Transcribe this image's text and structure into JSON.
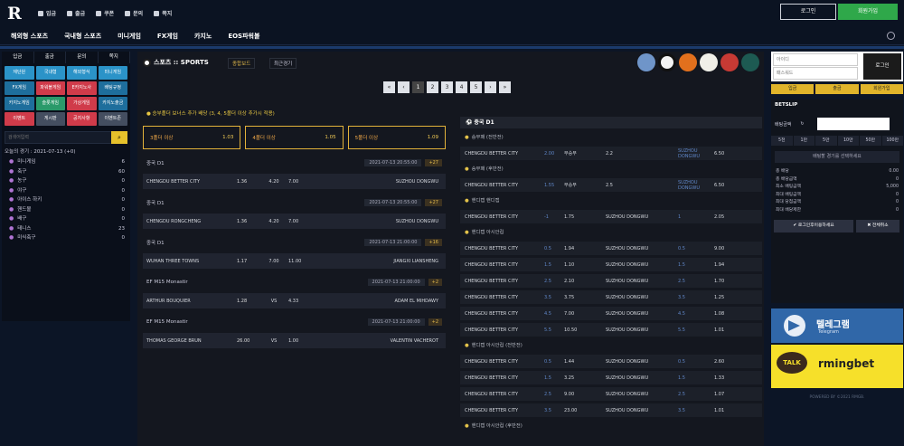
{
  "header": {
    "logo": "R",
    "links": [
      "입금",
      "출금",
      "쿠폰",
      "문의",
      "쪽지"
    ],
    "login": "로그인",
    "join": "회원가입"
  },
  "nav": {
    "items": [
      "해외형 스포츠",
      "국내형 스포츠",
      "미니게임",
      "FX게임",
      "카지노",
      "EOS파워볼"
    ]
  },
  "left": {
    "tabs": [
      "입금",
      "출금",
      "문의",
      "쪽지"
    ],
    "grid": [
      [
        "재단원",
        "#2b93c8"
      ],
      [
        "국내형",
        "#2b93c8"
      ],
      [
        "해외형식",
        "#2b93c8"
      ],
      [
        "미니게임",
        "#2b93c8"
      ],
      [
        "FX게임",
        "#1e6e9c"
      ],
      [
        "파워볼게임",
        "#d03b4a"
      ],
      [
        "E카지노사",
        "#d03b4a"
      ],
      [
        "배팅규정",
        "#1e6e9c"
      ],
      [
        "카지노게임",
        "#1e6e9c"
      ],
      [
        "슬롯게임",
        "#2a9a6a"
      ],
      [
        "가상게임",
        "#d03b4a"
      ],
      [
        "카지노출금",
        "#1e6e9c"
      ],
      [
        "이벤트",
        "#d03b4a"
      ],
      [
        "게시판",
        "#444e60"
      ],
      [
        "공지사항",
        "#d03b4a"
      ],
      [
        "이벤트존",
        "#444e60"
      ]
    ],
    "search_placeholder": "검색어입력",
    "today": "오늘의 경기 : 2021-07-13 (+0)",
    "sports": [
      [
        "미니게임",
        "6"
      ],
      [
        "축구",
        "60"
      ],
      [
        "농구",
        "0"
      ],
      [
        "야구",
        "0"
      ],
      [
        "아이스 하키",
        "0"
      ],
      [
        "핸드볼",
        "0"
      ],
      [
        "배구",
        "0"
      ],
      [
        "테니스",
        "23"
      ],
      [
        "미식축구",
        "0"
      ]
    ]
  },
  "center": {
    "title": "스포츠 :: SPORTS",
    "tab1": "종합보드",
    "tab2": "최근경기",
    "pages": [
      "«",
      "‹",
      "1",
      "2",
      "3",
      "4",
      "5",
      "›",
      "»"
    ],
    "notice": "● 승부폴더 보너스 추가 배당 (3, 4, 5폴더 이상 추가시 적용)",
    "bonus": [
      {
        "label": "3폴더 이상",
        "val": "1.03"
      },
      {
        "label": "4폴더 이상",
        "val": "1.05"
      },
      {
        "label": "5폴더 이상",
        "val": "1.09"
      }
    ],
    "matches": [
      {
        "league": "중국 D1",
        "date": "2021-07-13 20:55:00",
        "plus": "+27",
        "home": "CHENGDU BETTER CITY",
        "ho": "1.36",
        "dr": "4.20",
        "ao": "7.00",
        "away": "SUZHOU DONGWU"
      },
      {
        "league": "중국 D1",
        "date": "2021-07-13 20:55:00",
        "plus": "+27",
        "home": "CHENGDU RONGCHENG",
        "ho": "1.36",
        "dr": "4.20",
        "ao": "7.00",
        "away": "SUZHOU DONGWU"
      },
      {
        "league": "중국 D1",
        "date": "2021-07-13 21:00:00",
        "plus": "+16",
        "home": "WUHAN THREE TOWNS",
        "ho": "1.17",
        "dr": "7.00",
        "ao": "11.00",
        "away": "JIANGXI LIANSHENG"
      },
      {
        "league": "EF M15 Monastir",
        "date": "2021-07-13 21:00:00",
        "plus": "+2",
        "home": "ARTHUR BOUQUIER",
        "ho": "1.28",
        "dr": "VS",
        "ao": "4.33",
        "away": "ADAM EL MIHDAWY"
      },
      {
        "league": "EF M15 Monastir",
        "date": "2021-07-13 21:00:00",
        "plus": "+2",
        "home": "THOMAS GEORGE BRUN",
        "ho": "26.00",
        "dr": "VS",
        "ao": "1.00",
        "away": "VALENTIN VACHEROT"
      }
    ],
    "detail": {
      "header": "중국 D1",
      "sections": [
        {
          "title": "승무패 (전반전)",
          "rows": [
            [
              "CHENGDU BETTER CITY",
              "2.00",
              "무승부",
              "2.2",
              "SUZHOU DONGWU",
              "6.50"
            ]
          ]
        },
        {
          "title": "승무패 (후반전)",
          "rows": [
            [
              "CHENGDU BETTER CITY",
              "1.55",
              "무승부",
              "2.5",
              "SUZHOU DONGWU",
              "6.50"
            ]
          ]
        },
        {
          "title": "핸디캡 핸디캡",
          "rows": [
            [
              "CHENGDU BETTER CITY",
              "-1",
              "1.75",
              "SUZHOU DONGWU",
              "1",
              "2.05"
            ]
          ]
        },
        {
          "title": "핸디캡 아시안컵",
          "rows": [
            [
              "CHENGDU BETTER CITY",
              "0.5",
              "1.94",
              "SUZHOU DONGWU",
              "0.5",
              "9.00"
            ],
            [
              "CHENGDU BETTER CITY",
              "1.5",
              "1.10",
              "SUZHOU DONGWU",
              "1.5",
              "1.94"
            ],
            [
              "CHENGDU BETTER CITY",
              "2.5",
              "2.10",
              "SUZHOU DONGWU",
              "2.5",
              "1.70"
            ],
            [
              "CHENGDU BETTER CITY",
              "3.5",
              "3.75",
              "SUZHOU DONGWU",
              "3.5",
              "1.25"
            ],
            [
              "CHENGDU BETTER CITY",
              "4.5",
              "7.00",
              "SUZHOU DONGWU",
              "4.5",
              "1.08"
            ],
            [
              "CHENGDU BETTER CITY",
              "5.5",
              "10.50",
              "SUZHOU DONGWU",
              "5.5",
              "1.01"
            ]
          ]
        },
        {
          "title": "핸디캡 아시안컵 (전반전)",
          "rows": [
            [
              "CHENGDU BETTER CITY",
              "0.5",
              "1.44",
              "SUZHOU DONGWU",
              "0.5",
              "2.60"
            ],
            [
              "CHENGDU BETTER CITY",
              "1.5",
              "3.25",
              "SUZHOU DONGWU",
              "1.5",
              "1.33"
            ],
            [
              "CHENGDU BETTER CITY",
              "2.5",
              "9.00",
              "SUZHOU DONGWU",
              "2.5",
              "1.07"
            ],
            [
              "CHENGDU BETTER CITY",
              "3.5",
              "23.00",
              "SUZHOU DONGWU",
              "3.5",
              "1.01"
            ]
          ]
        },
        {
          "title": "핸디캡 아시안컵 (후반전)",
          "rows": []
        }
      ]
    }
  },
  "right": {
    "id_placeholder": "아이디",
    "pw_placeholder": "패스워드",
    "login_btn": "로그인",
    "buttons": [
      "입금",
      "출금",
      "회원가입"
    ],
    "slip_title": "BETSLIP",
    "stake_label": "배팅금액",
    "amounts": [
      "5천",
      "1만",
      "5만",
      "10만",
      "50만",
      "100만"
    ],
    "empty": "배팅할 경기를 선택하세요",
    "info": [
      [
        "총 배당",
        "0.00"
      ],
      [
        "총 배당금액",
        "0"
      ],
      [
        "최소 배팅금액",
        "5,000"
      ],
      [
        "최대 배팅금액",
        "0"
      ],
      [
        "최대 당첨금액",
        "0"
      ],
      [
        "최대 배당제한",
        "0"
      ]
    ],
    "bet_btn": "✔ 로그인후이용하세요",
    "clear_btn": "✖ 전체취소",
    "telegram": "텔레그램",
    "telegram_sub": "Telegram",
    "kakao_talk": "TALK",
    "kakao_id": "rmingbet",
    "powered": "POWERED BY ©2021 RMGB."
  }
}
